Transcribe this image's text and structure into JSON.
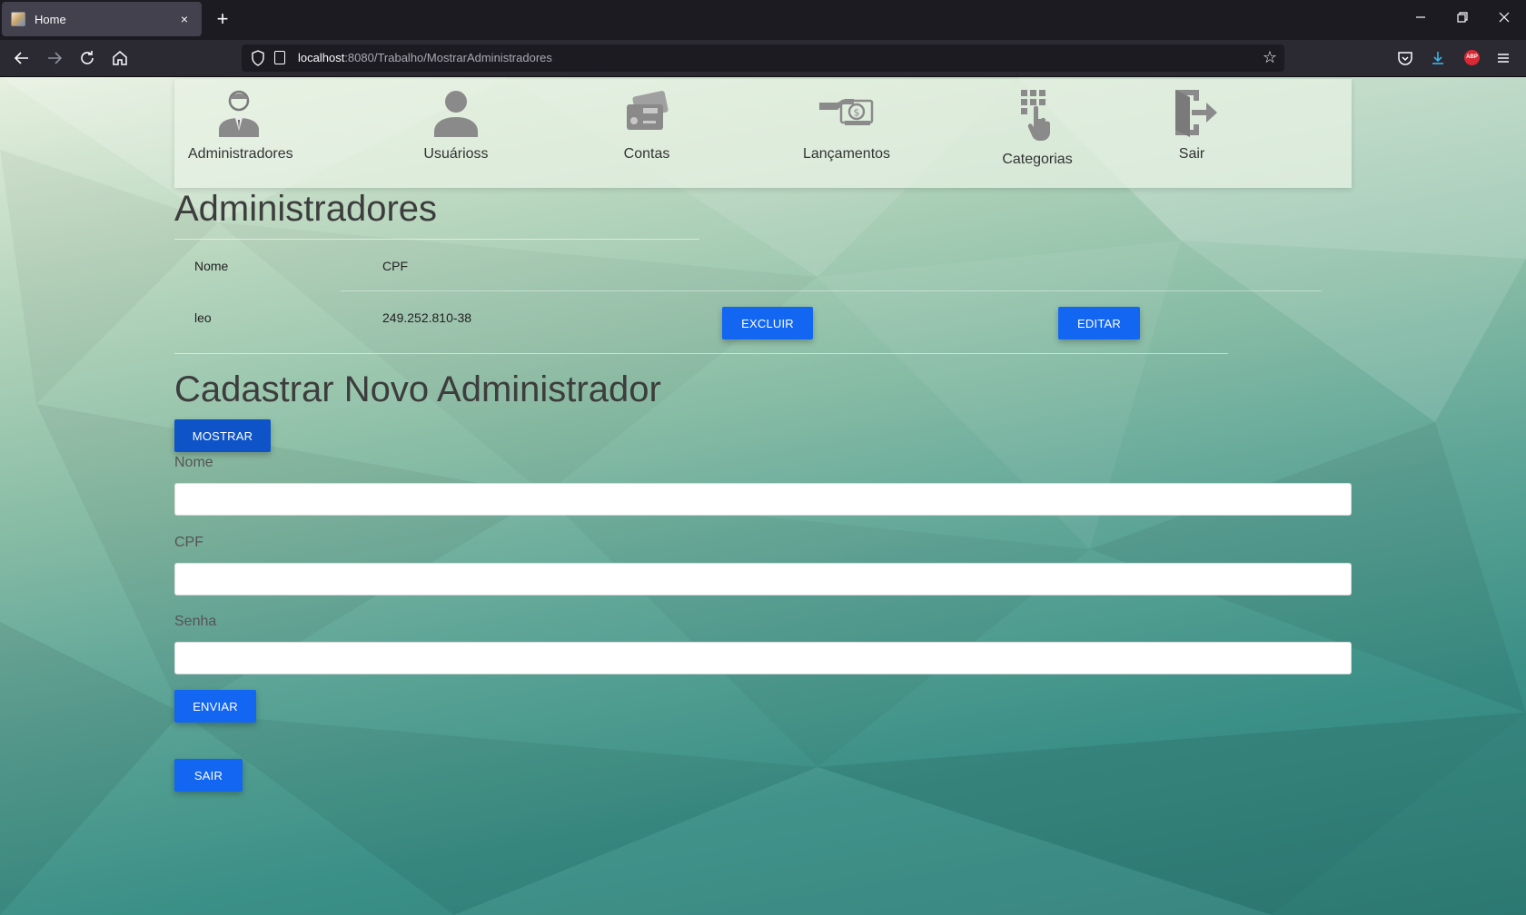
{
  "browser": {
    "tab_title": "Home",
    "tab_close": "×",
    "new_tab": "+",
    "url_host": "localhost",
    "url_path": ":8080/Trabalho/MostrarAdministradores",
    "abp_label": "ABP"
  },
  "menu": {
    "items": [
      {
        "label": "Administradores",
        "icon": "administrator-icon"
      },
      {
        "label": "Usuárioss",
        "icon": "user-icon"
      },
      {
        "label": "Contas",
        "icon": "credit-card-icon"
      },
      {
        "label": "Lançamentos",
        "icon": "cash-hand-icon"
      },
      {
        "label": "Categorias",
        "icon": "keypad-touch-icon"
      },
      {
        "label": "Sair",
        "icon": "logout-door-icon"
      }
    ]
  },
  "admins": {
    "title": "Administradores",
    "columns": [
      "Nome",
      "CPF"
    ],
    "rows": [
      {
        "nome": "leo",
        "cpf": "249.252.810-38",
        "delete_label": "EXCLUIR",
        "edit_label": "EDITAR"
      }
    ]
  },
  "form": {
    "title": "Cadastrar Novo Administrador",
    "toggle_label": "MOSTRAR",
    "nome_label": "Nome",
    "nome_value": "",
    "cpf_label": "CPF",
    "cpf_value": "",
    "senha_label": "Senha",
    "senha_value": "",
    "submit_label": "ENVIAR",
    "exit_label": "SAIR"
  }
}
